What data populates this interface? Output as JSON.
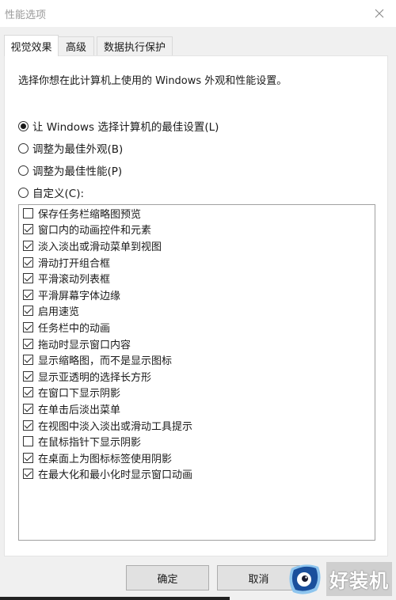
{
  "window": {
    "title": "性能选项",
    "close_icon": "close-icon"
  },
  "tabs": [
    {
      "label": "视觉效果",
      "active": true
    },
    {
      "label": "高级",
      "active": false
    },
    {
      "label": "数据执行保护",
      "active": false
    }
  ],
  "visual_effects": {
    "description": "选择你想在此计算机上使用的 Windows 外观和性能设置。",
    "radio_options": [
      {
        "label": "让 Windows 选择计算机的最佳设置(L)",
        "checked": true
      },
      {
        "label": "调整为最佳外观(B)",
        "checked": false
      },
      {
        "label": "调整为最佳性能(P)",
        "checked": false
      },
      {
        "label": "自定义(C):",
        "checked": false
      }
    ],
    "effects": [
      {
        "label": "保存任务栏缩略图预览",
        "checked": false
      },
      {
        "label": "窗口内的动画控件和元素",
        "checked": true
      },
      {
        "label": "淡入淡出或滑动菜单到视图",
        "checked": true
      },
      {
        "label": "滑动打开组合框",
        "checked": true
      },
      {
        "label": "平滑滚动列表框",
        "checked": true
      },
      {
        "label": "平滑屏幕字体边缘",
        "checked": true
      },
      {
        "label": "启用速览",
        "checked": true
      },
      {
        "label": "任务栏中的动画",
        "checked": true
      },
      {
        "label": "拖动时显示窗口内容",
        "checked": true
      },
      {
        "label": "显示缩略图，而不是显示图标",
        "checked": true
      },
      {
        "label": "显示亚透明的选择长方形",
        "checked": true
      },
      {
        "label": "在窗口下显示阴影",
        "checked": true
      },
      {
        "label": "在单击后淡出菜单",
        "checked": true
      },
      {
        "label": "在视图中淡入淡出或滑动工具提示",
        "checked": true
      },
      {
        "label": "在鼠标指针下显示阴影",
        "checked": false
      },
      {
        "label": "在桌面上为图标标签使用阴影",
        "checked": true
      },
      {
        "label": "在最大化和最小化时显示窗口动画",
        "checked": true
      }
    ]
  },
  "buttons": {
    "ok_label": "确定",
    "cancel_label": "取消"
  },
  "watermark": {
    "text": "好装机",
    "colors": {
      "logo_dark": "#1a4f9c",
      "logo_light": "#8ec5ee"
    }
  }
}
